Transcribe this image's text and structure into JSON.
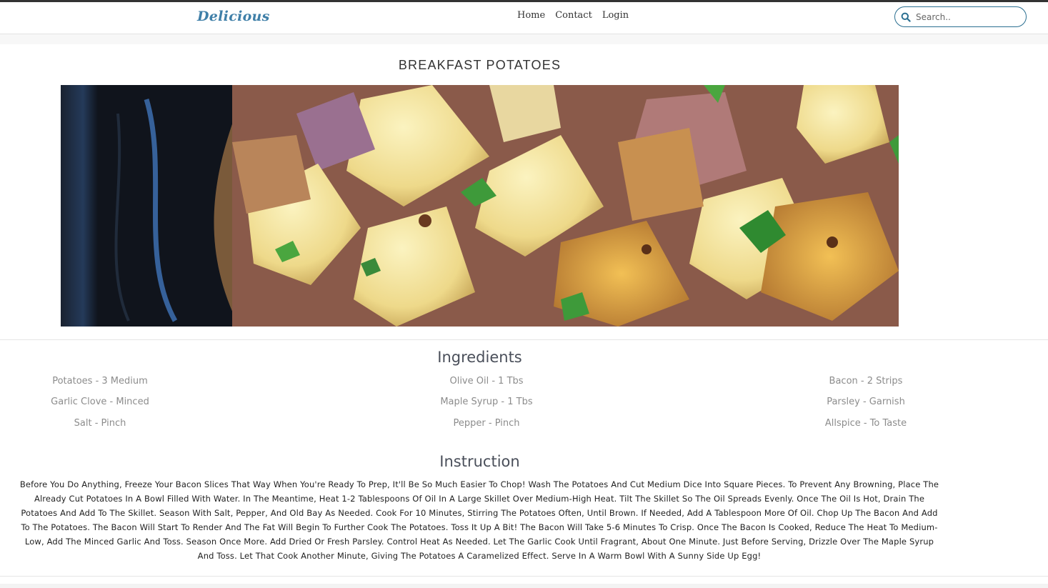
{
  "nav": {
    "brand": "Delicious",
    "links": [
      "Home",
      "Contact",
      "Login"
    ],
    "search_placeholder": "Search.."
  },
  "recipe": {
    "title": "BREAKFAST POTATOES",
    "image_alt": "Breakfast potatoes in a skillet",
    "ingredients_heading": "Ingredients",
    "ingredients": [
      [
        "Potatoes - 3 Medium",
        "Olive Oil - 1 Tbs",
        "Bacon - 2 Strips"
      ],
      [
        "Garlic Clove - Minced",
        "Maple Syrup - 1 Tbs",
        "Parsley - Garnish"
      ],
      [
        "Salt - Pinch",
        "Pepper - Pinch",
        "Allspice - To Taste"
      ]
    ],
    "instruction_heading": "Instruction",
    "instruction": "Before You Do Anything, Freeze Your Bacon Slices That Way When You're Ready To Prep, It'll Be So Much Easier To Chop! Wash The Potatoes And Cut Medium Dice Into Square Pieces. To Prevent Any Browning, Place The Already Cut Potatoes In A Bowl Filled With Water. In The Meantime, Heat 1-2 Tablespoons Of Oil In A Large Skillet Over Medium-High Heat. Tilt The Skillet So The Oil Spreads Evenly. Once The Oil Is Hot, Drain The Potatoes And Add To The Skillet. Season With Salt, Pepper, And Old Bay As Needed. Cook For 10 Minutes, Stirring The Potatoes Often, Until Brown. If Needed, Add A Tablespoon More Of Oil. Chop Up The Bacon And Add To The Potatoes. The Bacon Will Start To Render And The Fat Will Begin To Further Cook The Potatoes. Toss It Up A Bit! The Bacon Will Take 5-6 Minutes To Crisp. Once The Bacon Is Cooked, Reduce The Heat To Medium-Low, Add The Minced Garlic And Toss. Season Once More. Add Dried Or Fresh Parsley. Control Heat As Needed. Let The Garlic Cook Until Fragrant, About One Minute. Just Before Serving, Drizzle Over The Maple Syrup And Toss. Let That Cook Another Minute, Giving The Potatoes A Caramelized Effect. Serve In A Warm Bowl With A Sunny Side Up Egg!"
  },
  "colors": {
    "brand": "#3f7fa8",
    "search_border": "#2b6f91",
    "heading": "#4a4f5a",
    "ingredient_text": "#8c8c8c"
  }
}
